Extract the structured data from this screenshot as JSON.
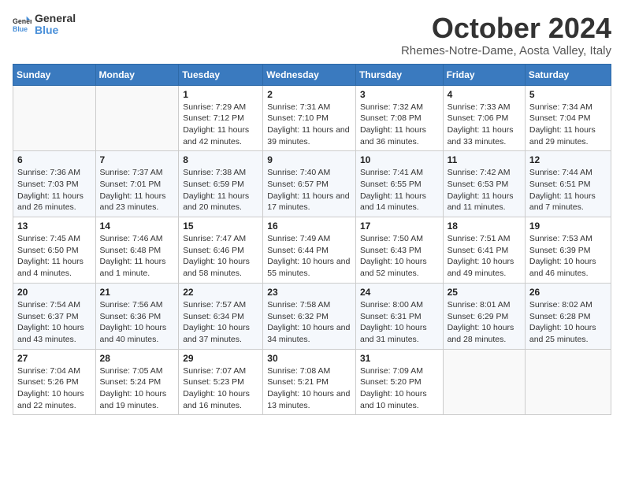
{
  "header": {
    "logo_line1": "General",
    "logo_line2": "Blue",
    "month": "October 2024",
    "location": "Rhemes-Notre-Dame, Aosta Valley, Italy"
  },
  "weekdays": [
    "Sunday",
    "Monday",
    "Tuesday",
    "Wednesday",
    "Thursday",
    "Friday",
    "Saturday"
  ],
  "weeks": [
    [
      {
        "day": "",
        "info": ""
      },
      {
        "day": "",
        "info": ""
      },
      {
        "day": "1",
        "info": "Sunrise: 7:29 AM\nSunset: 7:12 PM\nDaylight: 11 hours and 42 minutes."
      },
      {
        "day": "2",
        "info": "Sunrise: 7:31 AM\nSunset: 7:10 PM\nDaylight: 11 hours and 39 minutes."
      },
      {
        "day": "3",
        "info": "Sunrise: 7:32 AM\nSunset: 7:08 PM\nDaylight: 11 hours and 36 minutes."
      },
      {
        "day": "4",
        "info": "Sunrise: 7:33 AM\nSunset: 7:06 PM\nDaylight: 11 hours and 33 minutes."
      },
      {
        "day": "5",
        "info": "Sunrise: 7:34 AM\nSunset: 7:04 PM\nDaylight: 11 hours and 29 minutes."
      }
    ],
    [
      {
        "day": "6",
        "info": "Sunrise: 7:36 AM\nSunset: 7:03 PM\nDaylight: 11 hours and 26 minutes."
      },
      {
        "day": "7",
        "info": "Sunrise: 7:37 AM\nSunset: 7:01 PM\nDaylight: 11 hours and 23 minutes."
      },
      {
        "day": "8",
        "info": "Sunrise: 7:38 AM\nSunset: 6:59 PM\nDaylight: 11 hours and 20 minutes."
      },
      {
        "day": "9",
        "info": "Sunrise: 7:40 AM\nSunset: 6:57 PM\nDaylight: 11 hours and 17 minutes."
      },
      {
        "day": "10",
        "info": "Sunrise: 7:41 AM\nSunset: 6:55 PM\nDaylight: 11 hours and 14 minutes."
      },
      {
        "day": "11",
        "info": "Sunrise: 7:42 AM\nSunset: 6:53 PM\nDaylight: 11 hours and 11 minutes."
      },
      {
        "day": "12",
        "info": "Sunrise: 7:44 AM\nSunset: 6:51 PM\nDaylight: 11 hours and 7 minutes."
      }
    ],
    [
      {
        "day": "13",
        "info": "Sunrise: 7:45 AM\nSunset: 6:50 PM\nDaylight: 11 hours and 4 minutes."
      },
      {
        "day": "14",
        "info": "Sunrise: 7:46 AM\nSunset: 6:48 PM\nDaylight: 11 hours and 1 minute."
      },
      {
        "day": "15",
        "info": "Sunrise: 7:47 AM\nSunset: 6:46 PM\nDaylight: 10 hours and 58 minutes."
      },
      {
        "day": "16",
        "info": "Sunrise: 7:49 AM\nSunset: 6:44 PM\nDaylight: 10 hours and 55 minutes."
      },
      {
        "day": "17",
        "info": "Sunrise: 7:50 AM\nSunset: 6:43 PM\nDaylight: 10 hours and 52 minutes."
      },
      {
        "day": "18",
        "info": "Sunrise: 7:51 AM\nSunset: 6:41 PM\nDaylight: 10 hours and 49 minutes."
      },
      {
        "day": "19",
        "info": "Sunrise: 7:53 AM\nSunset: 6:39 PM\nDaylight: 10 hours and 46 minutes."
      }
    ],
    [
      {
        "day": "20",
        "info": "Sunrise: 7:54 AM\nSunset: 6:37 PM\nDaylight: 10 hours and 43 minutes."
      },
      {
        "day": "21",
        "info": "Sunrise: 7:56 AM\nSunset: 6:36 PM\nDaylight: 10 hours and 40 minutes."
      },
      {
        "day": "22",
        "info": "Sunrise: 7:57 AM\nSunset: 6:34 PM\nDaylight: 10 hours and 37 minutes."
      },
      {
        "day": "23",
        "info": "Sunrise: 7:58 AM\nSunset: 6:32 PM\nDaylight: 10 hours and 34 minutes."
      },
      {
        "day": "24",
        "info": "Sunrise: 8:00 AM\nSunset: 6:31 PM\nDaylight: 10 hours and 31 minutes."
      },
      {
        "day": "25",
        "info": "Sunrise: 8:01 AM\nSunset: 6:29 PM\nDaylight: 10 hours and 28 minutes."
      },
      {
        "day": "26",
        "info": "Sunrise: 8:02 AM\nSunset: 6:28 PM\nDaylight: 10 hours and 25 minutes."
      }
    ],
    [
      {
        "day": "27",
        "info": "Sunrise: 7:04 AM\nSunset: 5:26 PM\nDaylight: 10 hours and 22 minutes."
      },
      {
        "day": "28",
        "info": "Sunrise: 7:05 AM\nSunset: 5:24 PM\nDaylight: 10 hours and 19 minutes."
      },
      {
        "day": "29",
        "info": "Sunrise: 7:07 AM\nSunset: 5:23 PM\nDaylight: 10 hours and 16 minutes."
      },
      {
        "day": "30",
        "info": "Sunrise: 7:08 AM\nSunset: 5:21 PM\nDaylight: 10 hours and 13 minutes."
      },
      {
        "day": "31",
        "info": "Sunrise: 7:09 AM\nSunset: 5:20 PM\nDaylight: 10 hours and 10 minutes."
      },
      {
        "day": "",
        "info": ""
      },
      {
        "day": "",
        "info": ""
      }
    ]
  ]
}
